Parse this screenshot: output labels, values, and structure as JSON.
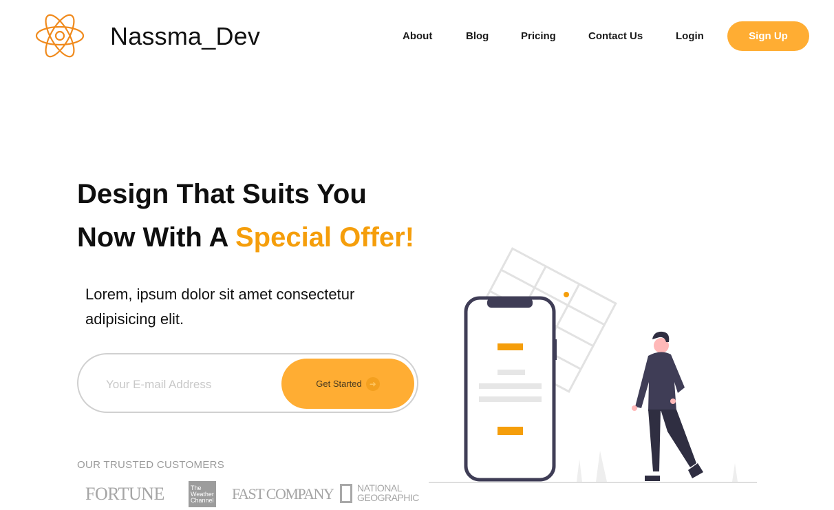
{
  "header": {
    "logo_icon": "atom-icon",
    "brand": "Nassma_Dev",
    "nav": [
      "About",
      "Blog",
      "Pricing",
      "Contact Us",
      "Login"
    ],
    "signup_label": "Sign Up"
  },
  "hero": {
    "title_line1": "Design That Suits You",
    "title_line2_prefix": "Now With A ",
    "title_line2_accent": "Special Offer!",
    "subtitle": "Lorem, ipsum dolor sit amet consectetur adipisicing elit.",
    "email_placeholder": "Your E-mail Address",
    "cta_label": "Get Started",
    "cta_icon": "arrow-right-icon"
  },
  "trusted": {
    "heading": "OUR TRUSTED CUSTOMERS",
    "logos": [
      "FORTUNE",
      "The Weather Channel",
      "FAST COMPANY",
      "NATIONAL GEOGRAPHIC"
    ]
  },
  "colors": {
    "accent": "#ffad33",
    "accent_text": "#f59e0b",
    "dark": "#3f3d56"
  }
}
